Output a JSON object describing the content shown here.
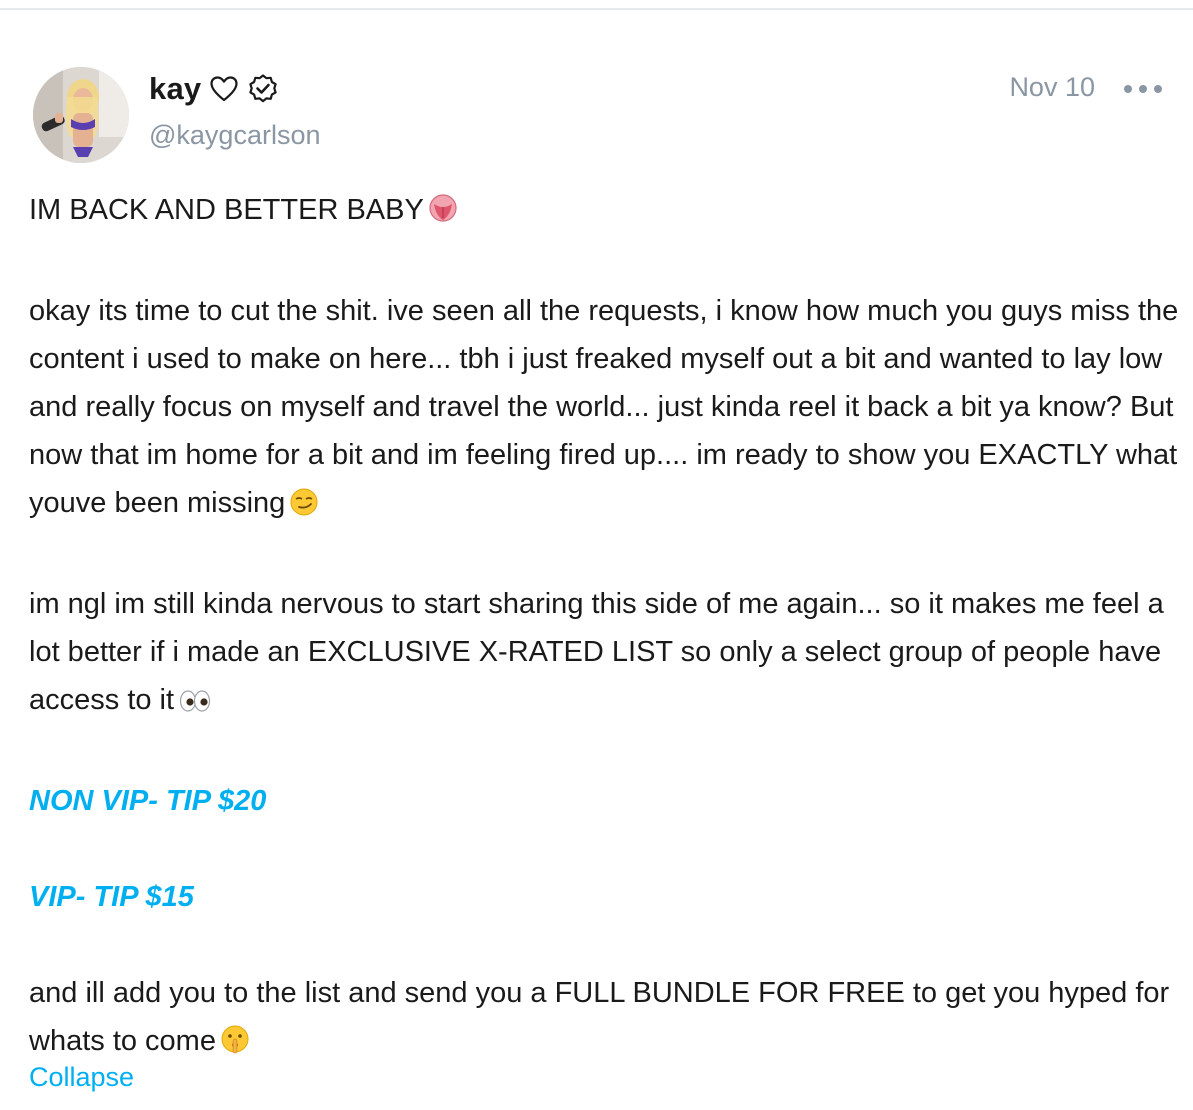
{
  "post": {
    "author": {
      "display_name": "kay",
      "heart_icon": "heart-outline-icon",
      "verified_icon": "verified-badge-icon",
      "handle": "@kaygcarlson",
      "avatar": "profile-photo"
    },
    "date": "Nov 10",
    "more_icon": "more-dots-icon",
    "body": {
      "line_1": "IM BACK AND BETTER BABY",
      "line_1_emoji": "tongue-face-emoji",
      "paragraph_2": "okay its time to cut the shit. ive seen all the requests, i know how much you guys miss the content i used to make on here... tbh i just freaked myself out a bit and wanted to lay low and really focus on myself and travel the world... just kinda reel it back a bit ya know? But now that im home for a bit and im feeling fired up.... im ready to show you EXACTLY what youve been missing",
      "paragraph_2_emoji": "smirk-face-emoji",
      "paragraph_3": "im ngl im still kinda nervous to start sharing this side of me again... so it makes me feel a lot better if i made an EXCLUSIVE X-RATED LIST so only a select group of people have access to it",
      "paragraph_3_emoji": "eyes-emoji",
      "tier_non_vip": "NON VIP- TIP $20",
      "tier_vip": "VIP- TIP $15",
      "paragraph_4": "and ill add you to the list and send you a FULL BUNDLE FOR FREE to get you hyped for whats to come",
      "paragraph_4_emoji": "shushing-face-emoji"
    },
    "collapse_label": "Collapse"
  },
  "colors": {
    "accent": "#00aff0",
    "muted_text": "#8a96a3",
    "body_text": "#1a1a1a",
    "divider": "#e6e8ec"
  }
}
